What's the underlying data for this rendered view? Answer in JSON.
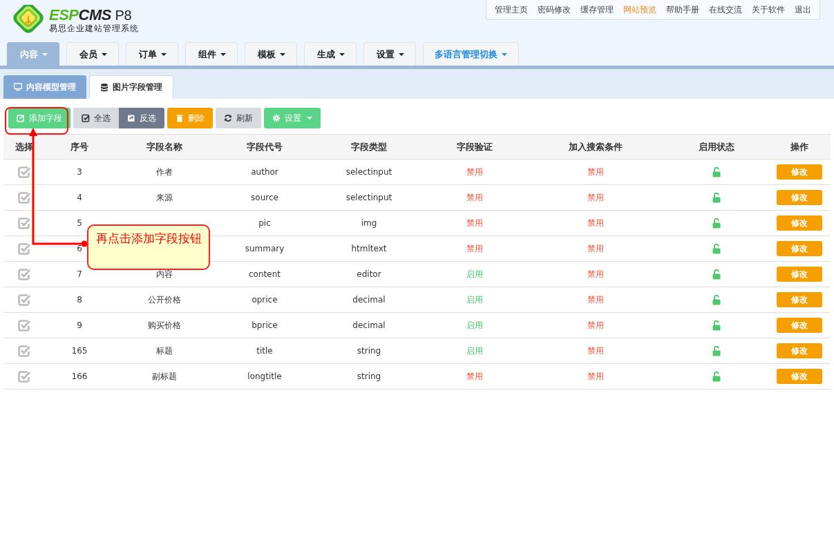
{
  "logo": {
    "brand_green": "ESP",
    "brand_dark": "CMS",
    "version": "P8",
    "subtitle": "易思企业建站管理系统"
  },
  "top_links": [
    {
      "label": "管理主页",
      "highlight": false
    },
    {
      "label": "密码修改",
      "highlight": false
    },
    {
      "label": "缓存管理",
      "highlight": false
    },
    {
      "label": "网站预览",
      "highlight": true
    },
    {
      "label": "帮助手册",
      "highlight": false
    },
    {
      "label": "在线交流",
      "highlight": false
    },
    {
      "label": "关于软件",
      "highlight": false
    },
    {
      "label": "退出",
      "highlight": false
    }
  ],
  "nav_tabs": [
    {
      "label": "内容",
      "selected": true,
      "accent": false
    },
    {
      "label": "会员",
      "selected": false,
      "accent": false
    },
    {
      "label": "订单",
      "selected": false,
      "accent": false
    },
    {
      "label": "组件",
      "selected": false,
      "accent": false
    },
    {
      "label": "模板",
      "selected": false,
      "accent": false
    },
    {
      "label": "生成",
      "selected": false,
      "accent": false
    },
    {
      "label": "设置",
      "selected": false,
      "accent": false
    },
    {
      "label": "多语言管理切换",
      "selected": false,
      "accent": true
    }
  ],
  "sub_tabs": [
    {
      "label": "内容模型管理",
      "selected": false
    },
    {
      "label": "图片字段管理",
      "selected": true
    }
  ],
  "toolbar": [
    {
      "label": "添加字段",
      "kind": "add",
      "dropdown": false
    },
    {
      "label": "全选",
      "kind": "select",
      "dropdown": false
    },
    {
      "label": "反选",
      "kind": "invert",
      "dropdown": false
    },
    {
      "label": "删除",
      "kind": "delete",
      "dropdown": false
    },
    {
      "label": "刷新",
      "kind": "refresh",
      "dropdown": false
    },
    {
      "label": "设置",
      "kind": "settings",
      "dropdown": true
    }
  ],
  "table": {
    "columns": [
      "选择",
      "序号",
      "字段名称",
      "字段代号",
      "字段类型",
      "字段验证",
      "加入搜索条件",
      "启用状态",
      "操作"
    ],
    "rows": [
      {
        "checked": true,
        "no": "3",
        "name": "作者",
        "code": "author",
        "type": "selectinput",
        "validation": {
          "text": "禁用",
          "on": false
        },
        "search": {
          "text": "禁用",
          "on": false
        },
        "unlocked": true,
        "action": "修改"
      },
      {
        "checked": true,
        "no": "4",
        "name": "来源",
        "code": "source",
        "type": "selectinput",
        "validation": {
          "text": "禁用",
          "on": false
        },
        "search": {
          "text": "禁用",
          "on": false
        },
        "unlocked": true,
        "action": "修改"
      },
      {
        "checked": true,
        "no": "5",
        "code": "pic",
        "type": "img",
        "validation": {
          "text": "禁用",
          "on": false
        },
        "search": {
          "text": "禁用",
          "on": false
        },
        "unlocked": true,
        "action": "修改"
      },
      {
        "checked": true,
        "no": "6",
        "code": "summary",
        "type": "htmltext",
        "validation": {
          "text": "禁用",
          "on": false
        },
        "search": {
          "text": "禁用",
          "on": false
        },
        "unlocked": true,
        "action": "修改"
      },
      {
        "checked": true,
        "no": "7",
        "name": "内容",
        "code": "content",
        "type": "editor",
        "validation": {
          "text": "启用",
          "on": true
        },
        "search": {
          "text": "禁用",
          "on": false
        },
        "unlocked": true,
        "action": "修改"
      },
      {
        "checked": true,
        "no": "8",
        "name": "公开价格",
        "code": "oprice",
        "type": "decimal",
        "validation": {
          "text": "启用",
          "on": true
        },
        "search": {
          "text": "禁用",
          "on": false
        },
        "unlocked": true,
        "action": "修改"
      },
      {
        "checked": true,
        "no": "9",
        "name": "购买价格",
        "code": "bprice",
        "type": "decimal",
        "validation": {
          "text": "启用",
          "on": true
        },
        "search": {
          "text": "禁用",
          "on": false
        },
        "unlocked": true,
        "action": "修改"
      },
      {
        "checked": true,
        "no": "165",
        "name": "标题",
        "code": "title",
        "type": "string",
        "validation": {
          "text": "启用",
          "on": true
        },
        "search": {
          "text": "禁用",
          "on": false
        },
        "unlocked": true,
        "action": "修改"
      },
      {
        "checked": true,
        "no": "166",
        "name": "副标题",
        "code": "longtitle",
        "type": "string",
        "validation": {
          "text": "禁用",
          "on": false
        },
        "search": {
          "text": "禁用",
          "on": false
        },
        "unlocked": true,
        "action": "修改"
      }
    ]
  },
  "annotation": {
    "text": "再点击添加字段按钮"
  }
}
